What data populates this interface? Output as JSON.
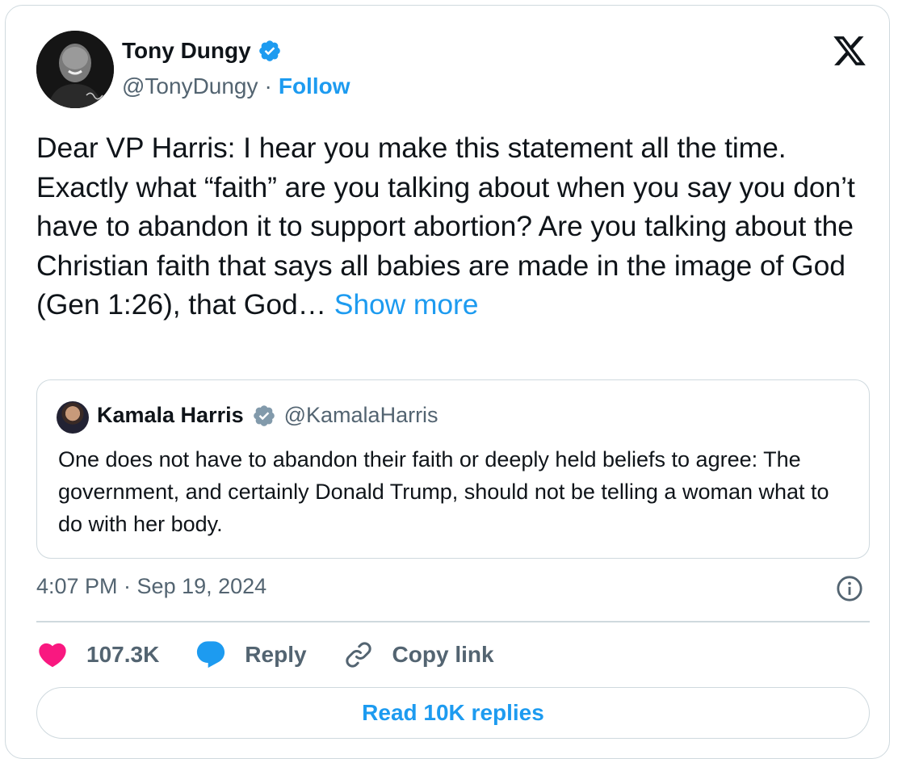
{
  "author": {
    "name": "Tony Dungy",
    "handle": "@TonyDungy",
    "separator": "·",
    "follow_label": "Follow"
  },
  "tweet": {
    "text": "Dear VP Harris: I hear you make this statement all the time. Exactly what “faith” are you talking about when you say you don’t have to abandon it to support abortion?  Are you talking about the Christian faith that says all babies are made in the image of God (Gen 1:26), that God… ",
    "show_more_label": "Show more"
  },
  "quote": {
    "name": "Kamala Harris",
    "handle": "@KamalaHarris",
    "text": "One does not have to abandon their faith or deeply held beliefs to agree: The government, and certainly Donald Trump, should not be telling a woman what to do with her body."
  },
  "timestamp": "4:07 PM · Sep 19, 2024",
  "actions": {
    "like_count": "107.3K",
    "reply_label": "Reply",
    "copy_link_label": "Copy link"
  },
  "read_replies_label": "Read 10K replies",
  "colors": {
    "accent": "#1d9bf0",
    "like": "#f91880",
    "muted": "#536471",
    "border": "#cfd9de",
    "verified_blue": "#1d9bf0",
    "verified_gray": "#829aab"
  },
  "icons": [
    "verified-badge-icon",
    "x-logo-icon",
    "info-icon",
    "heart-icon",
    "reply-icon",
    "link-icon"
  ]
}
